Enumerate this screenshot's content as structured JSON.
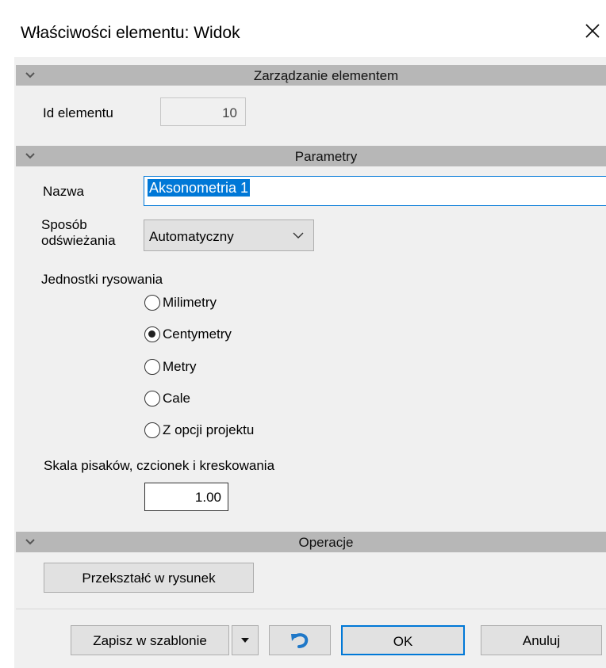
{
  "window": {
    "title": "Właściwości elementu: Widok",
    "close_icon": "close-icon"
  },
  "sections": {
    "management": {
      "title": "Zarządzanie elementem"
    },
    "parameters": {
      "title": "Parametry"
    },
    "operations": {
      "title": "Operacje"
    }
  },
  "element_id": {
    "label": "Id elementu",
    "value": "10"
  },
  "name": {
    "label": "Nazwa",
    "value": "Aksonometria 1"
  },
  "refresh": {
    "label_line1": "Sposób",
    "label_line2": "odświeżania",
    "selected": "Automatyczny"
  },
  "units": {
    "label": "Jednostki rysowania",
    "options": [
      "Milimetry",
      "Centymetry",
      "Metry",
      "Cale",
      "Z opcji projektu"
    ],
    "selected_index": 1
  },
  "scale": {
    "label": "Skala pisaków, czcionek i kreskowania",
    "value": "1.00"
  },
  "buttons": {
    "convert": "Przekształć w rysunek",
    "save_template": "Zapisz w szablonie",
    "ok": "OK",
    "cancel": "Anuluj"
  },
  "colors": {
    "section_bg": "#b7b7b7",
    "client_bg": "#f0f0f0",
    "focus": "#0078d7",
    "undo_icon": "#1f78c8"
  }
}
